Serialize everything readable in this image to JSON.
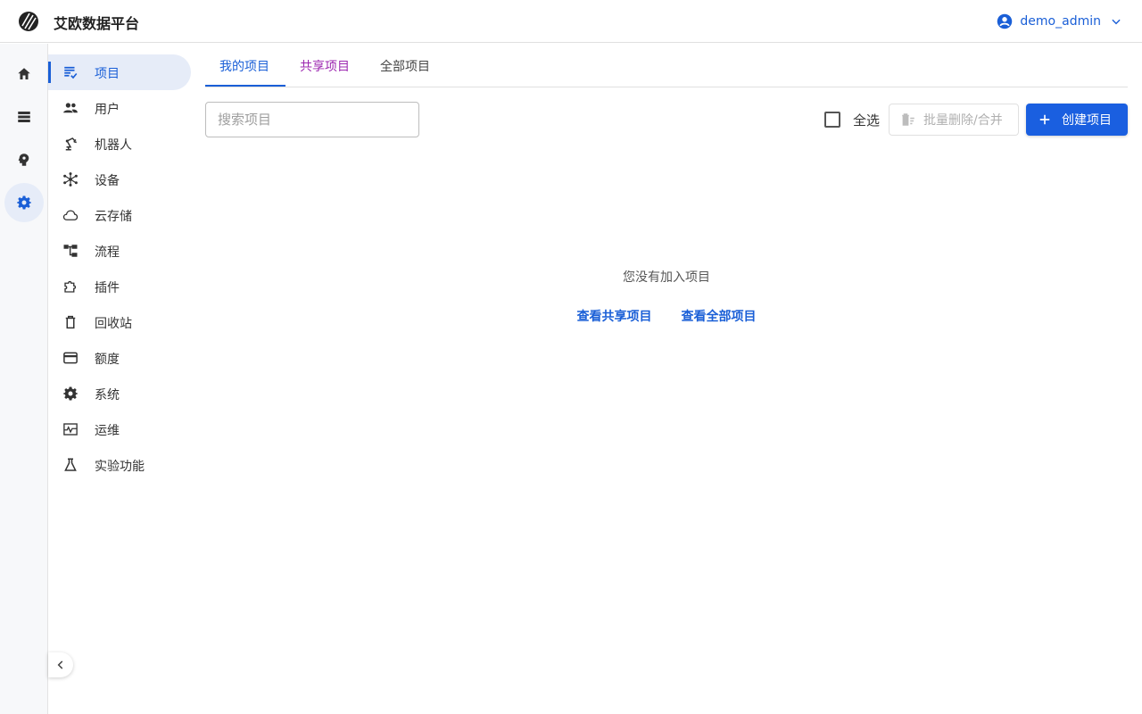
{
  "app": {
    "title": "艾欧数据平台"
  },
  "user": {
    "name": "demo_admin"
  },
  "rail": {
    "items": [
      {
        "icon": "home-icon"
      },
      {
        "icon": "storage-icon"
      },
      {
        "icon": "brain-icon"
      },
      {
        "icon": "gear-icon",
        "active": true
      }
    ]
  },
  "sidebar": {
    "items": [
      {
        "label": "项目",
        "icon": "projects-icon",
        "active": true
      },
      {
        "label": "用户",
        "icon": "users-icon"
      },
      {
        "label": "机器人",
        "icon": "robot-arm-icon"
      },
      {
        "label": "设备",
        "icon": "device-hub-icon"
      },
      {
        "label": "云存储",
        "icon": "cloud-icon"
      },
      {
        "label": "流程",
        "icon": "workflow-icon"
      },
      {
        "label": "插件",
        "icon": "plugin-icon"
      },
      {
        "label": "回收站",
        "icon": "trash-icon"
      },
      {
        "label": "额度",
        "icon": "credit-card-icon"
      },
      {
        "label": "系统",
        "icon": "gear-icon"
      },
      {
        "label": "运维",
        "icon": "monitoring-icon"
      },
      {
        "label": "实验功能",
        "icon": "flask-icon"
      }
    ]
  },
  "tabs": {
    "mine": "我的项目",
    "shared": "共享项目",
    "all": "全部项目"
  },
  "toolbar": {
    "search_placeholder": "搜索项目",
    "select_all": "全选",
    "bulk_delete": "批量删除/合并",
    "create": "创建项目"
  },
  "empty": {
    "message": "您没有加入项目",
    "view_shared": "查看共享项目",
    "view_all": "查看全部项目"
  },
  "colors": {
    "accent": "#1a5fd7",
    "shared_tab": "#9c27b0",
    "primary_button": "#1a5fe0"
  }
}
